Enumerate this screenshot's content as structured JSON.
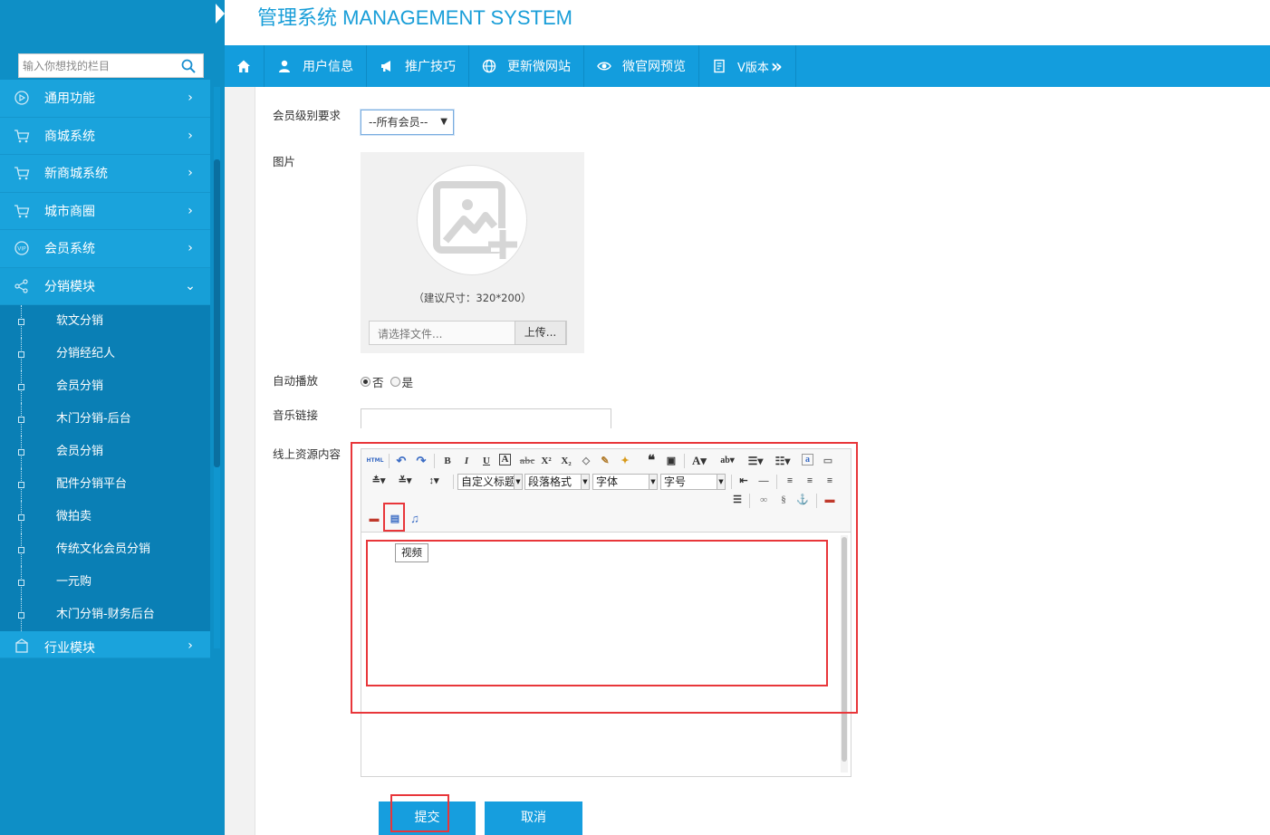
{
  "brand": {
    "title": "管理系统 MANAGEMENT SYSTEM"
  },
  "sidebar": {
    "search_placeholder": "输入你想找的栏目",
    "menu": [
      {
        "label": "通用功能",
        "icon": "play-circle-icon"
      },
      {
        "label": "商城系统",
        "icon": "cart-icon"
      },
      {
        "label": "新商城系统",
        "icon": "cart-icon"
      },
      {
        "label": "城市商圈",
        "icon": "cart-icon"
      },
      {
        "label": "会员系统",
        "icon": "vip-icon"
      },
      {
        "label": "分销模块",
        "icon": "share-icon"
      },
      {
        "label": "行业模块",
        "icon": "cube-icon"
      }
    ],
    "submenu": [
      {
        "label": "软文分销"
      },
      {
        "label": "分销经纪人"
      },
      {
        "label": "会员分销"
      },
      {
        "label": "木门分销-后台"
      },
      {
        "label": "会员分销"
      },
      {
        "label": "配件分销平台"
      },
      {
        "label": "微拍卖"
      },
      {
        "label": "传统文化会员分销"
      },
      {
        "label": "一元购"
      },
      {
        "label": "木门分销-财务后台"
      }
    ]
  },
  "topnav": [
    {
      "label": "用户信息",
      "icon": "user-icon"
    },
    {
      "label": "推广技巧",
      "icon": "megaphone-icon"
    },
    {
      "label": "更新微网站",
      "icon": "globe-icon"
    },
    {
      "label": "微官网预览",
      "icon": "eye-icon"
    },
    {
      "label": "V版本",
      "icon": "document-icon",
      "suffix": "»"
    }
  ],
  "form": {
    "member_level_label": "会员级别要求",
    "member_level_value": "--所有会员--",
    "image_label": "图片",
    "image_hint": "（建议尺寸：320*200）",
    "file_placeholder": "请选择文件...",
    "upload_label": "上传...",
    "autoplay_label": "自动播放",
    "autoplay_options": [
      "否",
      "是"
    ],
    "autoplay_selected": "否",
    "music_label": "音乐链接",
    "music_value": "",
    "content_label": "线上资源内容"
  },
  "editor": {
    "combo_custom_title": "自定义标题",
    "combo_paragraph": "段落格式",
    "combo_font": "字体",
    "combo_size": "字号",
    "tooltip": "视频",
    "html_label": "HTML"
  },
  "actions": {
    "submit": "提交",
    "cancel": "取消"
  },
  "colors": {
    "accent": "#169ede",
    "sidebar": "#0e8fc6",
    "annotation": "#e8363a"
  }
}
